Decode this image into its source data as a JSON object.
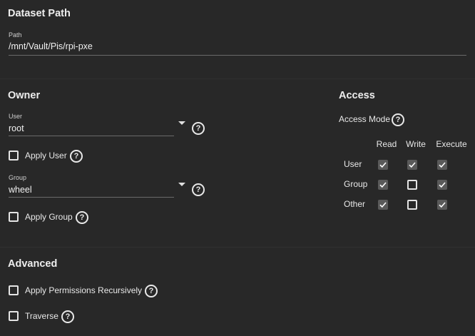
{
  "dataset": {
    "title": "Dataset Path",
    "path_label": "Path",
    "path_value": "/mnt/Vault/Pis/rpi-pxe"
  },
  "owner": {
    "title": "Owner",
    "user_label": "User",
    "user_value": "root",
    "apply_user_label": "Apply User",
    "group_label": "Group",
    "group_value": "wheel",
    "apply_group_label": "Apply Group",
    "help_glyph": "?"
  },
  "access": {
    "title": "Access",
    "mode_label": "Access Mode",
    "columns": [
      "Read",
      "Write",
      "Execute"
    ],
    "rows": [
      {
        "label": "User",
        "values": [
          true,
          true,
          true
        ]
      },
      {
        "label": "Group",
        "values": [
          true,
          false,
          true
        ]
      },
      {
        "label": "Other",
        "values": [
          true,
          false,
          true
        ]
      }
    ]
  },
  "advanced": {
    "title": "Advanced",
    "recursive_label": "Apply Permissions Recursively",
    "traverse_label": "Traverse"
  },
  "colors": {
    "background": "#282828",
    "checked_fill": "#5a5a5a",
    "text": "#e8e8e8"
  },
  "icons": {
    "help": "help-circle-icon",
    "check": "check-icon",
    "dropdown": "caret-down-icon"
  }
}
